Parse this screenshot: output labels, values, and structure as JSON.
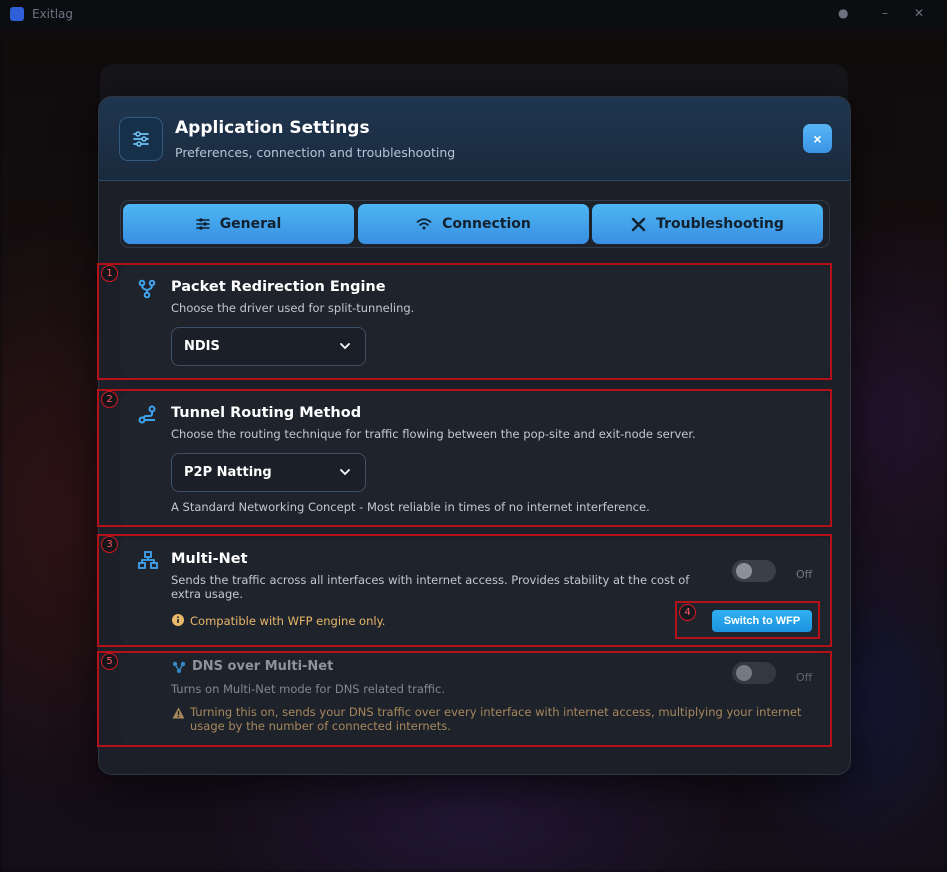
{
  "app": {
    "title": "Exitlag"
  },
  "modal": {
    "title": "Application Settings",
    "subtitle": "Preferences, connection and troubleshooting",
    "close_label": "×"
  },
  "tabs": [
    {
      "label": "General",
      "icon": "sliders-icon"
    },
    {
      "label": "Connection",
      "icon": "wifi-icon"
    },
    {
      "label": "Troubleshooting",
      "icon": "tools-icon"
    }
  ],
  "settings": {
    "packet_engine": {
      "title": "Packet Redirection Engine",
      "description": "Choose the driver used for split-tunneling.",
      "selected": "NDIS"
    },
    "routing": {
      "title": "Tunnel Routing Method",
      "description": "Choose the routing technique for traffic flowing between the pop-site and exit-node server.",
      "selected": "P2P Natting",
      "note": "A Standard Networking Concept - Most reliable in times of no internet interference."
    },
    "multinet": {
      "title": "Multi-Net",
      "description": "Sends the traffic across all interfaces with internet access. Provides stability at the cost of extra usage.",
      "toggle_state": "Off",
      "compat_note": "Compatible with WFP engine only.",
      "switch_label": "Switch to WFP"
    },
    "dns_multinet": {
      "title": "DNS over Multi-Net",
      "description": "Turns on Multi-Net mode for DNS related traffic.",
      "toggle_state": "Off",
      "warning": "Turning this on, sends your DNS traffic over every interface with internet access, multiplying your internet usage by the number of connected internets."
    }
  },
  "annotations": [
    "1",
    "2",
    "3",
    "4",
    "5"
  ],
  "colors": {
    "accent": "#3a9be8",
    "annotation": "#b3121a",
    "warning": "#e8b86b"
  }
}
